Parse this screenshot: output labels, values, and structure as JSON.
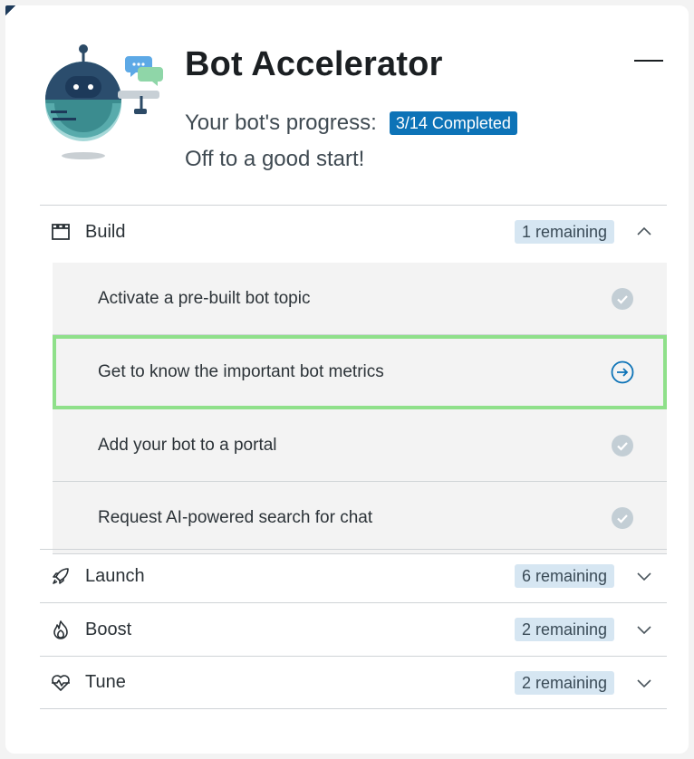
{
  "header": {
    "title": "Bot Accelerator",
    "progress_label": "Your bot's progress:",
    "progress_badge": "3/14 Completed",
    "progress_message": "Off to a good start!"
  },
  "sections": [
    {
      "label": "Build",
      "remaining": "1 remaining",
      "icon": "build-icon",
      "expanded": true,
      "tasks": [
        {
          "label": "Activate a pre-built bot topic",
          "status": "completed"
        },
        {
          "label": "Get to know the important bot metrics",
          "status": "current"
        },
        {
          "label": "Add your bot to a portal",
          "status": "completed"
        },
        {
          "label": "Request AI-powered search for chat",
          "status": "completed"
        }
      ]
    },
    {
      "label": "Launch",
      "remaining": "6 remaining",
      "icon": "rocket-icon",
      "expanded": false
    },
    {
      "label": "Boost",
      "remaining": "2 remaining",
      "icon": "flame-icon",
      "expanded": false
    },
    {
      "label": "Tune",
      "remaining": "2 remaining",
      "icon": "heartbeat-icon",
      "expanded": false
    }
  ],
  "colors": {
    "accent": "#0d73b7",
    "badge_bg": "#d6e6f2",
    "highlight_border": "#8fe08a",
    "check_gray": "#b7c3cb"
  }
}
